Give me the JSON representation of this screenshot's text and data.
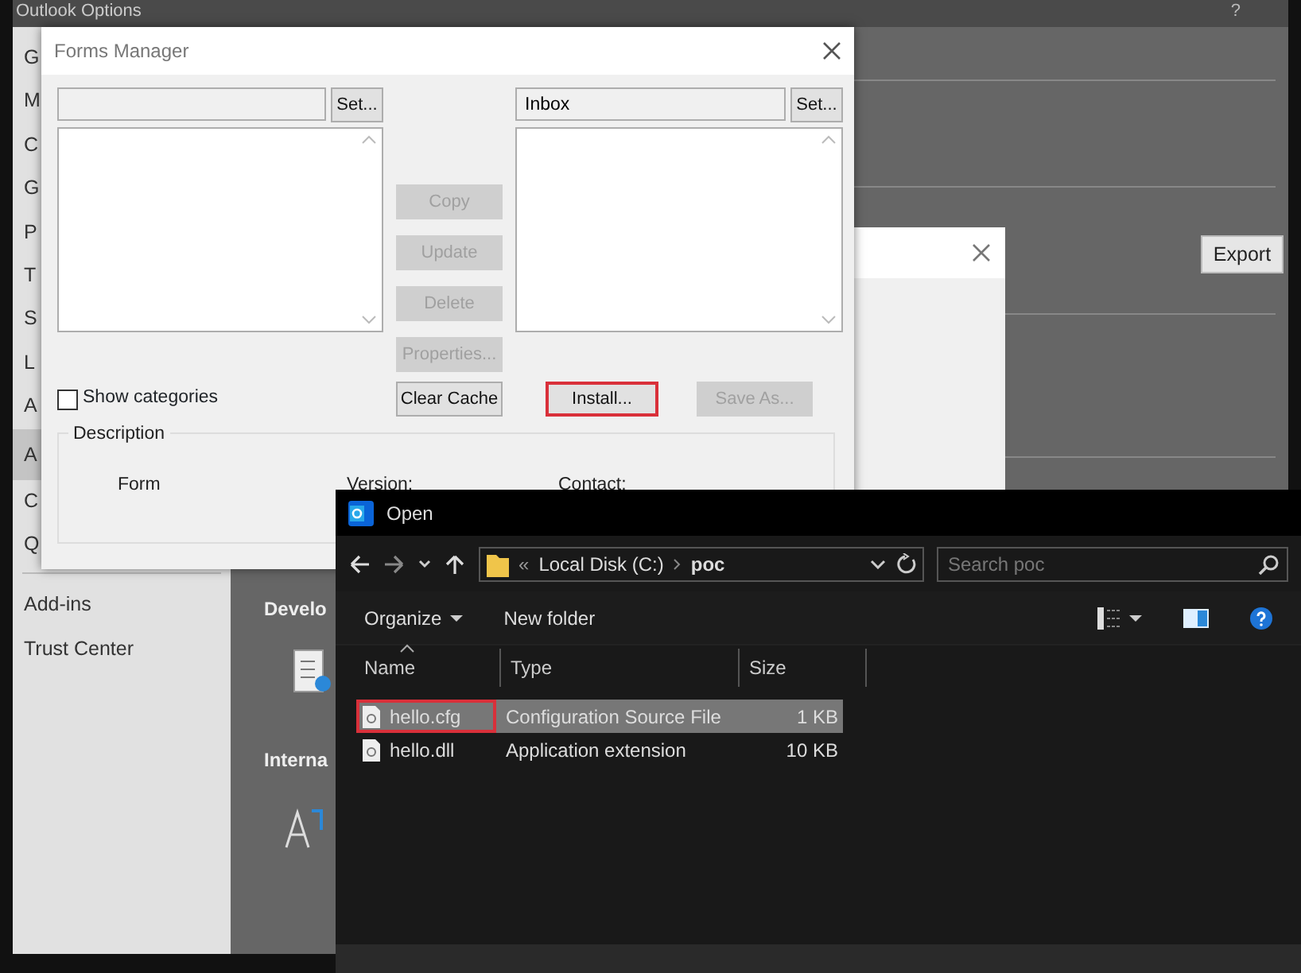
{
  "outlook_options": {
    "title": "Outlook Options",
    "help": "?",
    "sidebar": {
      "items": [
        {
          "label": "G",
          "selected": false
        },
        {
          "label": "M",
          "selected": false
        },
        {
          "label": "C",
          "selected": false
        },
        {
          "label": "G",
          "selected": false
        },
        {
          "label": "P",
          "selected": false
        },
        {
          "label": "T",
          "selected": false
        },
        {
          "label": "S",
          "selected": false
        },
        {
          "label": "L",
          "selected": false
        },
        {
          "label": "A",
          "selected": false
        },
        {
          "label": "A",
          "selected": true
        },
        {
          "label": "C",
          "selected": false
        },
        {
          "label": "Q",
          "selected": false
        }
      ],
      "lower_items": [
        {
          "label": "Add-ins",
          "selected": false
        },
        {
          "label": "Trust Center",
          "selected": false
        }
      ]
    },
    "export_button": "Export",
    "sections": [
      "Develo",
      "Interna"
    ]
  },
  "forms_manager": {
    "title": "Forms Manager",
    "left_set_button": "Set...",
    "right_field": {
      "value": "Inbox"
    },
    "right_set_button": "Set...",
    "middle_buttons": [
      {
        "label": "Copy",
        "disabled": true
      },
      {
        "label": "Update",
        "disabled": true
      },
      {
        "label": "Delete",
        "disabled": true
      },
      {
        "label": "Properties...",
        "disabled": true
      }
    ],
    "show_categories": {
      "label": "Show categories",
      "checked": false
    },
    "bottom_buttons": [
      {
        "label": "Clear Cache",
        "disabled": false,
        "highlighted": false
      },
      {
        "label": "Install...",
        "disabled": false,
        "highlighted": true
      },
      {
        "label": "Save As...",
        "disabled": true,
        "highlighted": false
      }
    ],
    "description": {
      "title": "Description",
      "labels": [
        "Form",
        "Version:",
        "Contact:"
      ]
    }
  },
  "open_dialog": {
    "title": "Open",
    "breadcrumb": {
      "prefix": "«",
      "parts": [
        "Local Disk (C:)",
        "poc"
      ]
    },
    "search": {
      "placeholder": "Search poc"
    },
    "toolbar": {
      "organize": "Organize",
      "new_folder": "New folder"
    },
    "columns": [
      "Name",
      "Type",
      "Size"
    ],
    "rows": [
      {
        "name": "hello.cfg",
        "type": "Configuration Source File",
        "size": "1 KB",
        "selected": true,
        "highlighted": true
      },
      {
        "name": "hello.dll",
        "type": "Application extension",
        "size": "10 KB",
        "selected": false,
        "highlighted": false
      }
    ]
  }
}
